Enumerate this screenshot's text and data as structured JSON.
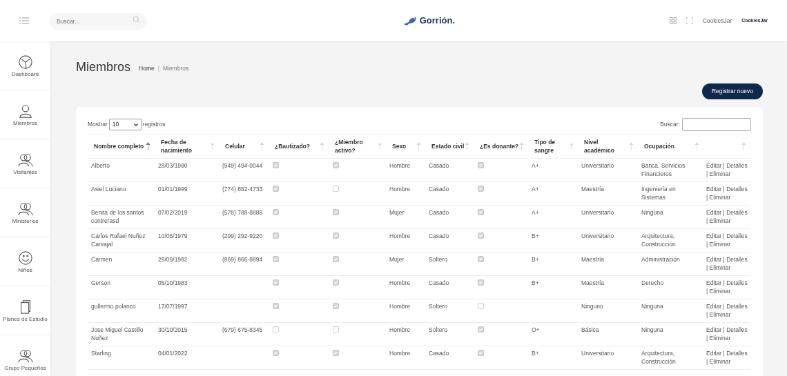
{
  "header": {
    "search_placeholder": "Buscar...",
    "brand": "Gorrión.",
    "user": "CookiesJar",
    "company_logo": "CookiesJar"
  },
  "sidebar": {
    "items": [
      {
        "label": "Dashboard",
        "kind": "dashboard"
      },
      {
        "label": "Miembros",
        "kind": "member"
      },
      {
        "label": "Visitantes",
        "kind": "people"
      },
      {
        "label": "Ministerios",
        "kind": "people"
      },
      {
        "label": "Niños",
        "kind": "smile"
      },
      {
        "label": "Planes de Estudio",
        "kind": "book"
      },
      {
        "label": "Grupo Pequeños",
        "kind": "people"
      }
    ]
  },
  "page": {
    "title": "Miembros",
    "breadcrumb": {
      "home": "Home",
      "separator": "|",
      "current": "Miembros"
    },
    "new_button": "Registrar nuevo"
  },
  "table_controls": {
    "show_label": "Mostrar",
    "page_size": "10",
    "records_label": "registros",
    "search_label": "Buscar:"
  },
  "table": {
    "columns": [
      {
        "label": "Nombre completo",
        "sorted": true
      },
      {
        "label": "Fecha de nacimiento",
        "sorted": false
      },
      {
        "label": "Celular",
        "sorted": false
      },
      {
        "label": "¿Bautizado?",
        "sorted": false
      },
      {
        "label": "¿Miembro activo?",
        "sorted": false
      },
      {
        "label": "Sexo",
        "sorted": false
      },
      {
        "label": "Estado civil",
        "sorted": false
      },
      {
        "label": "¿Es donante?",
        "sorted": false
      },
      {
        "label": "Tipo de sangre",
        "sorted": false
      },
      {
        "label": "Nivel académico",
        "sorted": false
      },
      {
        "label": "Ocupación",
        "sorted": false
      },
      {
        "sorted": false
      }
    ],
    "rows": [
      {
        "name": "Alberto",
        "birth": "28/03/1980",
        "phone": "(949) 494-0044",
        "baptized": true,
        "active": true,
        "sex": "Hombre",
        "civil": "Casado",
        "donor": true,
        "blood": "A+",
        "education": "Universitario",
        "occupation": "Banca, Servicios Financieros",
        "actions": "Editar | Detalles | Eliminar"
      },
      {
        "name": "Asiel Luciano",
        "birth": "01/01/1999",
        "phone": "(774) 852-4733",
        "baptized": true,
        "active": false,
        "sex": "Hombre",
        "civil": "Casado",
        "donor": true,
        "blood": "A+",
        "education": "Maestría",
        "occupation": "Ingeniería en Sistemas",
        "actions": "Editar | Detalles | Eliminar"
      },
      {
        "name": "Benita de los santos contrerasd",
        "birth": "07/02/2019",
        "phone": "(578) 788-8888",
        "baptized": true,
        "active": true,
        "sex": "Mujer",
        "civil": "Casado",
        "donor": true,
        "blood": "A+",
        "education": "Universitario",
        "occupation": "Ninguna",
        "actions": "Editar | Detalles | Eliminar"
      },
      {
        "name": "Carlos Rafael Nuñez Carvajal",
        "birth": "10/06/1979",
        "phone": "(299) 292-9220",
        "baptized": true,
        "active": true,
        "sex": "Hombre",
        "civil": "Casado",
        "donor": true,
        "blood": "B+",
        "education": "Universitario",
        "occupation": "Arquitectura, Construcción",
        "actions": "Editar | Detalles | Eliminar"
      },
      {
        "name": "Carmen",
        "birth": "29/09/1982",
        "phone": "(869) 866-8894",
        "baptized": true,
        "active": true,
        "sex": "Mujer",
        "civil": "Soltero",
        "donor": true,
        "blood": "B+",
        "education": "Maestría",
        "occupation": "Administración",
        "actions": "Editar | Detalles | Eliminar"
      },
      {
        "name": "Gerson",
        "birth": "05/10/1983",
        "baptized": true,
        "active": true,
        "sex": "Hombre",
        "civil": "Casado",
        "donor": true,
        "blood": "B+",
        "education": "Maestría",
        "occupation": "Derecho",
        "actions": "Editar | Detalles | Eliminar"
      },
      {
        "name": "gullermo polanco",
        "birth": "17/07/1997",
        "baptized": true,
        "active": true,
        "sex": "Hombre",
        "civil": "Soltero",
        "donor": false,
        "education": "Ninguno",
        "occupation": "Ninguna",
        "actions": "Editar | Detalles | Eliminar"
      },
      {
        "name": "Jose Miguel Castillo Nuñez",
        "birth": "30/10/2015",
        "phone": "(679) 675-8345",
        "baptized": false,
        "active": false,
        "sex": "Hombre",
        "civil": "Soltero",
        "donor": true,
        "blood": "O+",
        "education": "Básica",
        "occupation": "Ninguna",
        "actions": "Editar | Detalles | Eliminar"
      },
      {
        "name": "Starling",
        "birth": "04/01/2022",
        "baptized": true,
        "active": true,
        "sex": "Hombre",
        "civil": "Casado",
        "donor": true,
        "blood": "B+",
        "education": "Universitario",
        "occupation": "Arquitectura, Construcción",
        "actions": "Editar | Detalles | Eliminar"
      }
    ]
  }
}
